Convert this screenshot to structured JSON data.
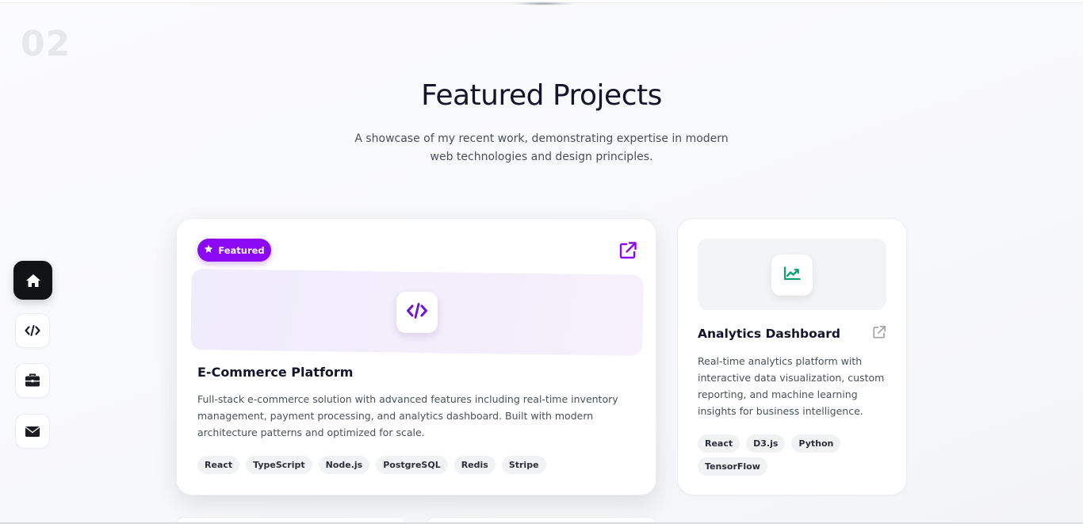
{
  "section": {
    "number": "02"
  },
  "header": {
    "title": "Featured Projects",
    "subtitle": "A showcase of my recent work, demonstrating expertise in modern web technologies and design principles."
  },
  "side_nav": {
    "items": [
      {
        "icon": "home-icon",
        "active": true
      },
      {
        "icon": "code-icon",
        "active": false
      },
      {
        "icon": "briefcase-icon",
        "active": false
      },
      {
        "icon": "envelope-icon",
        "active": false
      }
    ]
  },
  "projects": [
    {
      "badge": "Featured",
      "icon": "code-icon",
      "title": "E-Commerce Platform",
      "description": "Full-stack e-commerce solution with advanced features including real-time inventory management, payment processing, and analytics dashboard. Built with modern architecture patterns and optimized for scale.",
      "tags": [
        "React",
        "TypeScript",
        "Node.js",
        "PostgreSQL",
        "Redis",
        "Stripe"
      ]
    },
    {
      "icon": "chart-line-icon",
      "title": "Analytics Dashboard",
      "description": "Real-time analytics platform with interactive data visualization, custom reporting, and machine learning insights for business intelligence.",
      "tags": [
        "React",
        "D3.js",
        "Python",
        "TensorFlow"
      ]
    }
  ],
  "colors": {
    "accent": "#8b09f3",
    "accent_icon": "#6d12d6",
    "chart_icon": "#0e9f6e",
    "nav_active": "#111317",
    "text_primary": "#14152b",
    "text_secondary": "#4a4f5a"
  }
}
